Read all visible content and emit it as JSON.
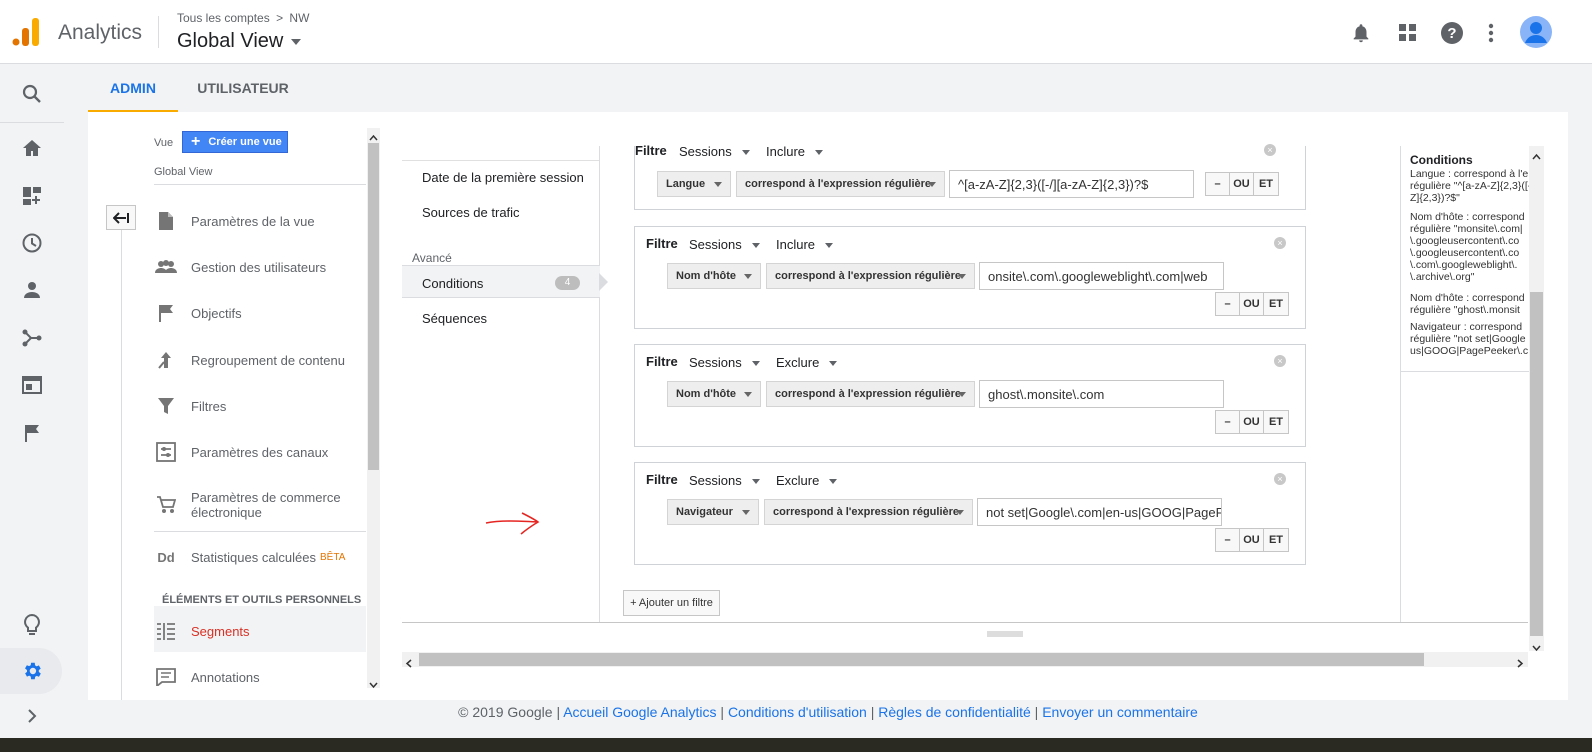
{
  "header": {
    "app_name": "Analytics",
    "breadcrumb": [
      "Tous les comptes",
      ">",
      "NW"
    ],
    "view_name": "Global View",
    "icons": [
      "bell-icon",
      "apps-grid-icon",
      "help-icon",
      "more-vert-icon",
      "avatar"
    ]
  },
  "siderail": {
    "icons": [
      "search-icon",
      "home-icon",
      "customization-icon",
      "realtime-icon",
      "audience-icon",
      "acquisition-icon",
      "behavior-icon",
      "conversions-icon",
      "lightbulb-icon",
      "gear-icon",
      "expand-icon"
    ]
  },
  "tabs": [
    {
      "label": "ADMIN",
      "active": true
    },
    {
      "label": "UTILISATEUR",
      "active": false
    }
  ],
  "admin_nav": {
    "vue_label": "Vue",
    "create_view_label": "Créer une vue",
    "view_name": "Global View",
    "items": [
      {
        "label": "Paramètres de la vue",
        "icon": "document-icon"
      },
      {
        "label": "Gestion des utilisateurs",
        "icon": "people-icon"
      },
      {
        "label": "Objectifs",
        "icon": "flag-icon"
      },
      {
        "label": "Regroupement de contenu",
        "icon": "content-grouping-icon"
      },
      {
        "label": "Filtres",
        "icon": "filter-icon"
      },
      {
        "label": "Paramètres des canaux",
        "icon": "channel-settings-icon"
      },
      {
        "label": "Paramètres de commerce électronique",
        "icon": "cart-icon"
      },
      {
        "label": "Statistiques calculées",
        "badge": "BÊTA",
        "icon": "calculated-metrics-icon"
      }
    ],
    "section_title": "ÉLÉMENTS ET OUTILS PERSONNELS",
    "personal_items": [
      {
        "label": "Segments",
        "icon": "segments-icon",
        "active": true
      },
      {
        "label": "Annotations",
        "icon": "annotation-icon"
      }
    ]
  },
  "segment_menu": {
    "items": [
      "Date de la première session",
      "Sources de trafic"
    ],
    "advanced_label": "Avancé",
    "conditions_label": "Conditions",
    "conditions_count": "4",
    "sequences_label": "Séquences"
  },
  "filters": [
    {
      "label": "Filtre",
      "scope": "Sessions",
      "mode": "Inclure",
      "dimension": "Langue",
      "operator": "correspond à l'expression régulière",
      "value": "^[a-zA-Z]{2,3}([-/][a-zA-Z]{2,3})?$"
    },
    {
      "label": "Filtre",
      "scope": "Sessions",
      "mode": "Inclure",
      "dimension": "Nom d'hôte",
      "operator": "correspond à l'expression régulière",
      "value": "onsite\\.com\\.googleweblight\\.com|web"
    },
    {
      "label": "Filtre",
      "scope": "Sessions",
      "mode": "Exclure",
      "dimension": "Nom d'hôte",
      "operator": "correspond à l'expression régulière",
      "value": "ghost\\.monsite\\.com"
    },
    {
      "label": "Filtre",
      "scope": "Sessions",
      "mode": "Exclure",
      "dimension": "Navigateur",
      "operator": "correspond à l'expression régulière",
      "value": "not set|Google\\.com|en-us|GOOG|PageF"
    }
  ],
  "filter_buttons": {
    "minus": "–",
    "or": "OU",
    "and": "ET"
  },
  "add_filter_label": "+ Ajouter un filtre",
  "summary": {
    "title": "Conditions",
    "lines": [
      [
        "Langue : correspond à l'e",
        "régulière \"^[a-zA-Z]{2,3}([-",
        "Z]{2,3})?$\""
      ],
      [
        "Nom d'hôte : correspond",
        "régulière \"monsite\\.com|",
        "\\.googleusercontent\\.co",
        "\\.googleusercontent\\.co",
        "\\.com\\.googleweblight\\.",
        "\\.archive\\.org\""
      ],
      [
        "Nom d'hôte : correspond",
        "régulière \"ghost\\.monsit"
      ],
      [
        "Navigateur : correspond",
        "régulière \"not set|Google",
        "us|GOOG|PagePeeker\\.c"
      ]
    ]
  },
  "footer": {
    "copyright": "© 2019 Google",
    "sep": "|",
    "links": [
      "Accueil Google Analytics",
      "Conditions d'utilisation",
      "Règles de confidentialité",
      "Envoyer un commentaire"
    ]
  }
}
